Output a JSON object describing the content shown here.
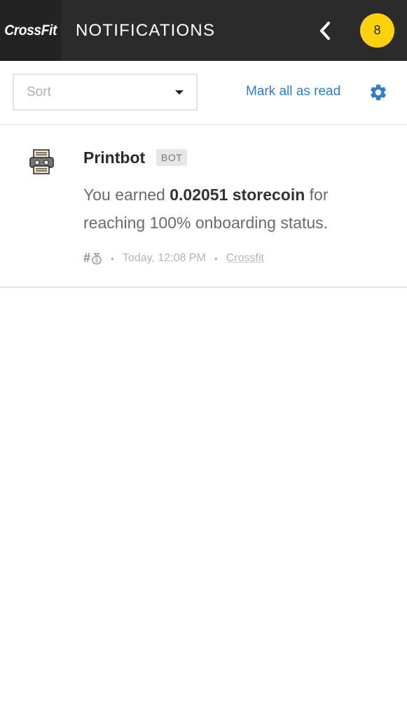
{
  "header": {
    "logo": "CrossFit",
    "title": "NOTIFICATIONS",
    "badge_count": "8",
    "badge_color": "#fcd20f",
    "back_icon": "chevron-left-icon"
  },
  "toolbar": {
    "sort_placeholder": "Sort",
    "mark_all_label": "Mark all as read",
    "settings_icon": "gear-icon",
    "accent_color": "#2a7fd4"
  },
  "notifications": [
    {
      "sender": "Printbot",
      "tag": "BOT",
      "message_prefix": "You earned ",
      "message_amount": "0.02051 storecoin",
      "message_suffix": " for reaching 100% onboarding status.",
      "meta_icon": "#",
      "meta_icon_name": "money-bag-icon",
      "timestamp": "Today, 12:08 PM",
      "channel": "Crossfit"
    }
  ]
}
